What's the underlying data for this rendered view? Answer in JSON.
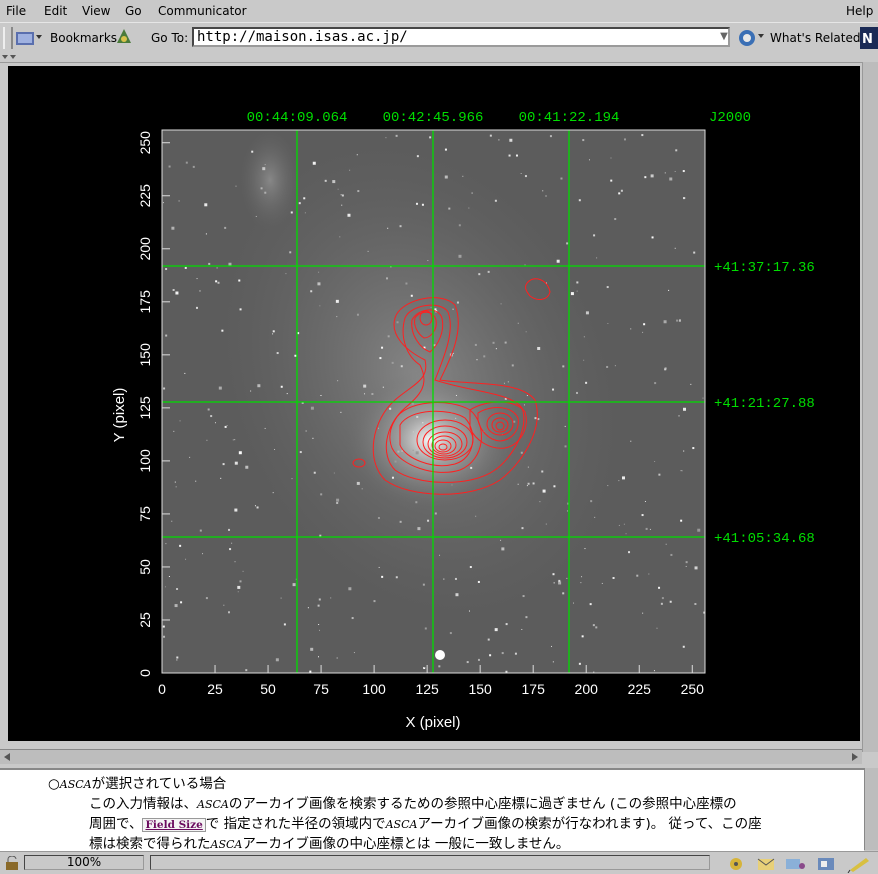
{
  "menu": {
    "items": [
      "File",
      "Edit",
      "View",
      "Go",
      "Communicator"
    ],
    "help": "Help"
  },
  "toolbar": {
    "bookmarks_label": "Bookmarks",
    "goto_label": "Go To:",
    "url": "http://maison.isas.ac.jp/",
    "whats_related": "What's Related"
  },
  "image": {
    "ra_labels": [
      "00:44:09.064",
      "00:42:45.966",
      "00:41:22.194"
    ],
    "equinox": "J2000",
    "dec_labels": [
      "+41:37:17.36",
      "+41:21:27.88",
      "+41:05:34.68"
    ],
    "x_axis_label": "X (pixel)",
    "y_axis_label": "Y (pixel)",
    "x_ticks": [
      "0",
      "25",
      "50",
      "75",
      "100",
      "125",
      "150",
      "175",
      "200",
      "225",
      "250"
    ],
    "y_ticks": [
      "0",
      "25",
      "50",
      "75",
      "100",
      "125",
      "150",
      "175",
      "200",
      "225",
      "250"
    ],
    "grid_color": "#00dd00",
    "contour_color": "#ff2020"
  },
  "text": {
    "bullet": "○",
    "line1_asca": "ASCA",
    "line1_rest": "が選択されている場合",
    "line2_a": "この入力情報は、",
    "line2_asca": "ASCA",
    "line2_b": "のアーカイブ画像を検索するための参照中心座標に過ぎません (この参照中心座標の",
    "line3_a": "周囲で、",
    "field_size": "Field Size",
    "line3_b": "で 指定された半径の領域内で",
    "line3_asca": "ASCA",
    "line3_c": "アーカイブ画像の検索が行なわれます)。 従って、この座",
    "line4_a": "標は検索で得られた",
    "line4_asca": "ASCA",
    "line4_b": "アーカイブ画像の中心座標とは 一般に一致しません。"
  },
  "status": {
    "zoom": "100%"
  }
}
